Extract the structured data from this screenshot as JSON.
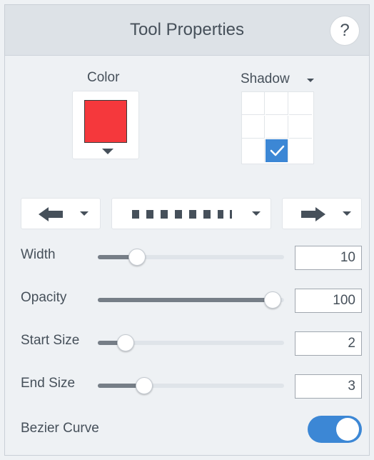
{
  "panel": {
    "title": "Tool Properties",
    "help_label": "?"
  },
  "color": {
    "label": "Color",
    "value": "#f5383c"
  },
  "shadow": {
    "label": "Shadow",
    "selected_position": "bottom-center"
  },
  "line": {
    "start_arrow_icon": "arrow-left-icon",
    "style_icon": "dashed-line-icon",
    "end_arrow_icon": "arrow-right-icon"
  },
  "properties": {
    "width": {
      "label": "Width",
      "value": "10",
      "level": 0.21
    },
    "opacity": {
      "label": "Opacity",
      "value": "100",
      "level": 0.94
    },
    "start_size": {
      "label": "Start Size",
      "value": "2",
      "level": 0.15
    },
    "end_size": {
      "label": "End Size",
      "value": "3",
      "level": 0.25
    }
  },
  "bezier": {
    "label": "Bezier Curve",
    "enabled": true
  },
  "colors": {
    "accent": "#3c87d5",
    "header": "#dde2e7",
    "background": "#eef1f4"
  }
}
